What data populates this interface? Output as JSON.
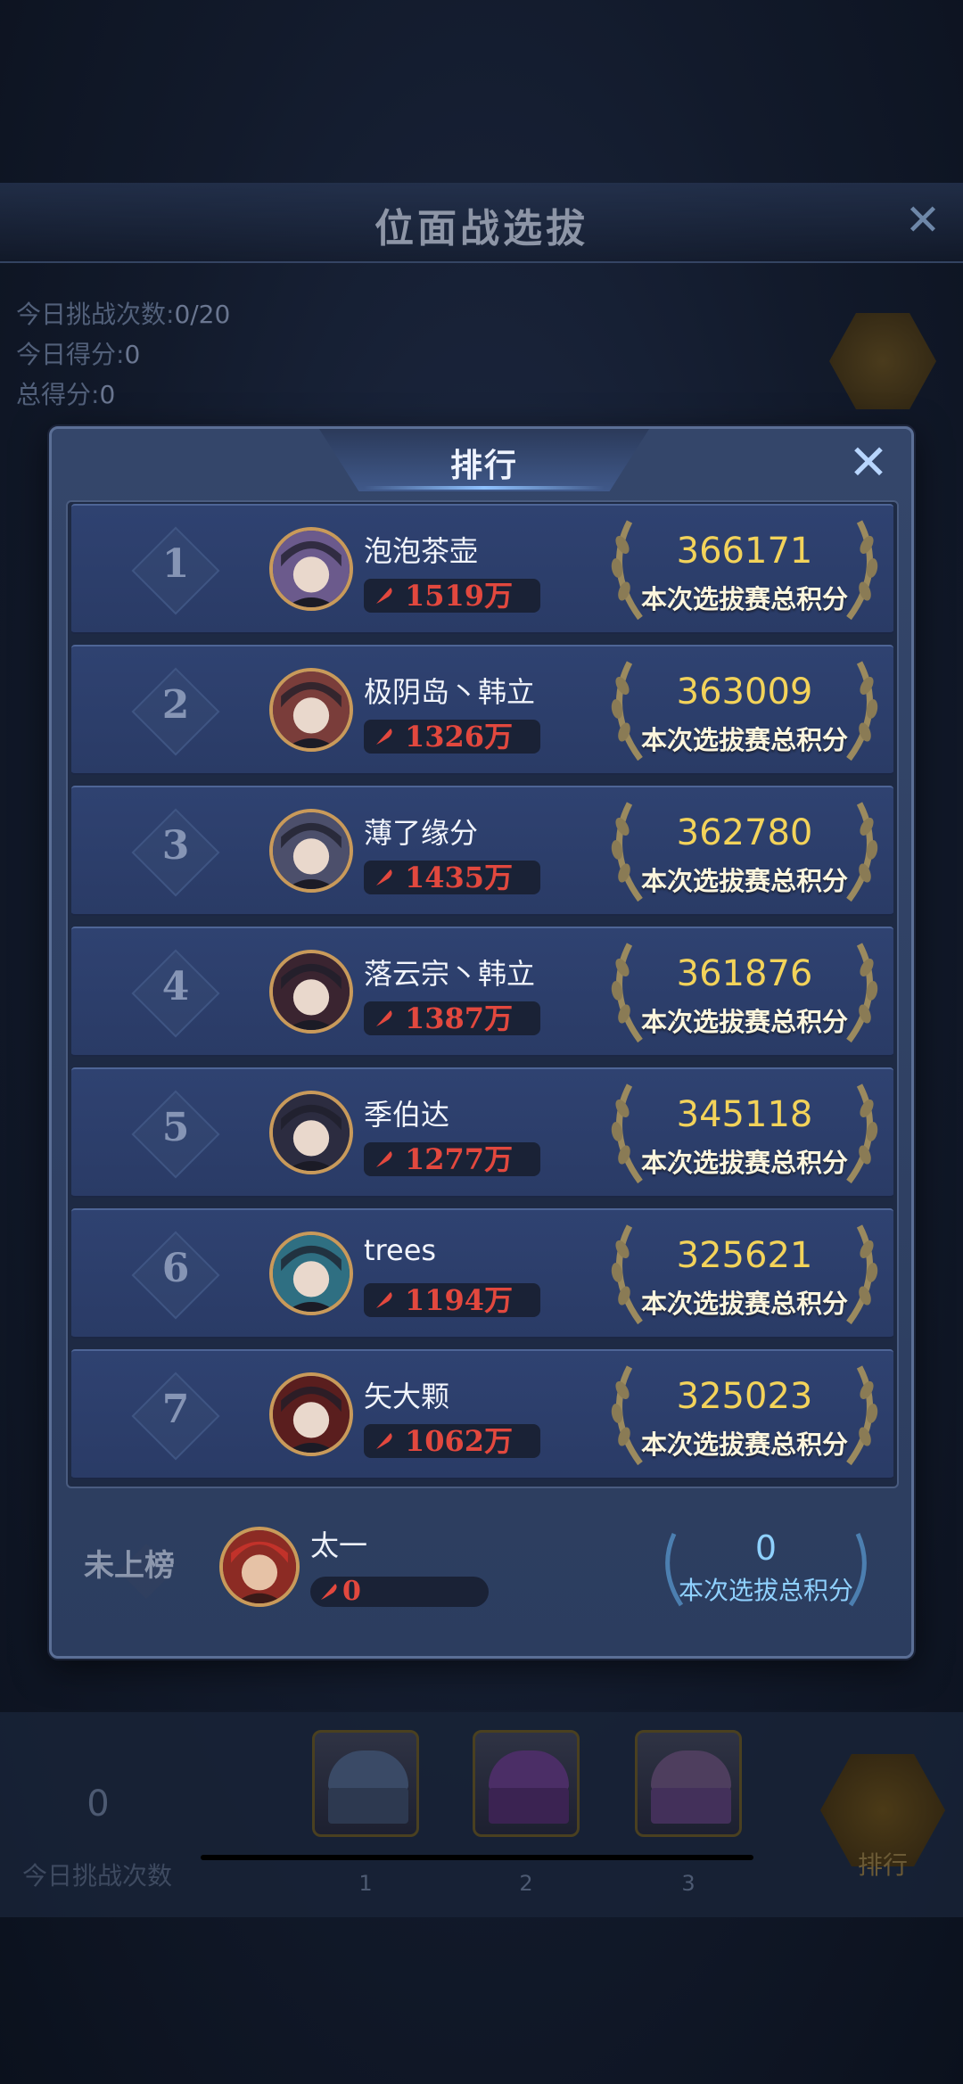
{
  "background": {
    "title": "位面战选拔",
    "stats": [
      {
        "label": "今日挑战次数:",
        "value": "0/20"
      },
      {
        "label": "今日得分:",
        "value": "0"
      },
      {
        "label": "总得分:",
        "value": "0"
      }
    ],
    "today_count_value": "0",
    "today_count_label": "今日挑战次数",
    "chest_labels": [
      "1",
      "2",
      "3"
    ],
    "rank_button_label": "排行"
  },
  "modal": {
    "title": "排行",
    "score_label": "本次选拔赛总积分",
    "rows": [
      {
        "rank": "1",
        "name": "泡泡茶壶",
        "power": "1519万",
        "score": "366171",
        "avatar_color": "#6b5a8c"
      },
      {
        "rank": "2",
        "name": "极阴岛丶韩立",
        "power": "1326万",
        "score": "363009",
        "avatar_color": "#7a3d3a"
      },
      {
        "rank": "3",
        "name": "薄了缘分",
        "power": "1435万",
        "score": "362780",
        "avatar_color": "#4c4f6b"
      },
      {
        "rank": "4",
        "name": "落云宗丶韩立",
        "power": "1387万",
        "score": "361876",
        "avatar_color": "#3a2430"
      },
      {
        "rank": "5",
        "name": "季伯达",
        "power": "1277万",
        "score": "345118",
        "avatar_color": "#2c2c40"
      },
      {
        "rank": "6",
        "name": "trees",
        "power": "1194万",
        "score": "325621",
        "avatar_color": "#2f6f82"
      },
      {
        "rank": "7",
        "name": "矢大颗",
        "power": "1062万",
        "score": "325023",
        "avatar_color": "#5a1e1e"
      }
    ],
    "self": {
      "rank_text": "未上榜",
      "name": "太一",
      "power": "0",
      "score": "0",
      "score_label": "本次选拔总积分",
      "avatar_color": "#8c2b24"
    }
  },
  "colors": {
    "score_gold": "#f3d35a",
    "power_red": "#e2483e",
    "self_score_blue": "#8fd1ff",
    "modal_bg": "#34466a"
  }
}
